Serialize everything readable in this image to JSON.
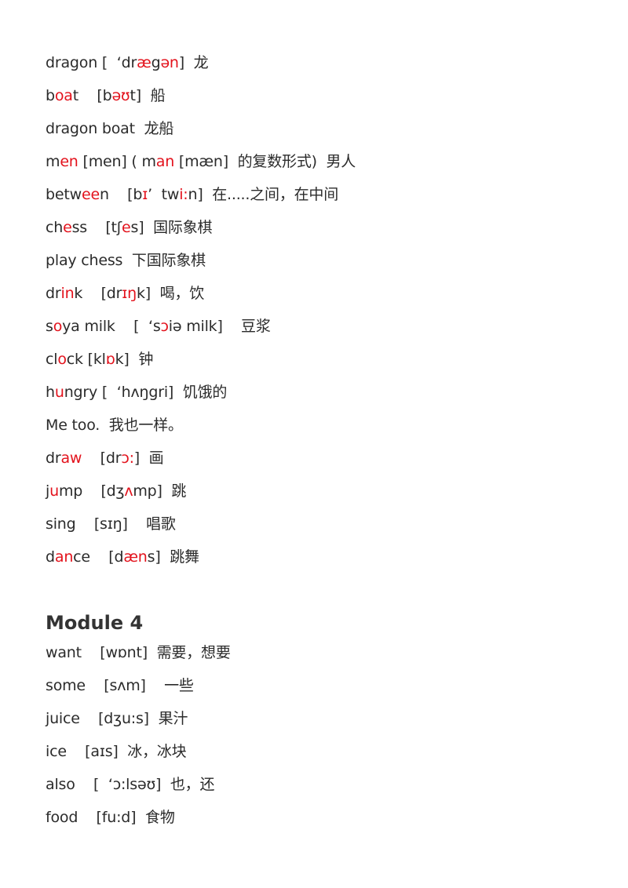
{
  "colors": {
    "text": "#2b2b2b",
    "highlight": "#e3121c"
  },
  "section1": {
    "entries": [
      {
        "id": "dragon",
        "segments": [
          {
            "t": "dragon [  ‘dr"
          },
          {
            "t": "æ",
            "h": true
          },
          {
            "t": "g"
          },
          {
            "t": "ən",
            "h": true
          },
          {
            "t": "]  龙"
          }
        ]
      },
      {
        "id": "boat",
        "segments": [
          {
            "t": "b"
          },
          {
            "t": "oa",
            "h": true
          },
          {
            "t": "t    [b"
          },
          {
            "t": "əʊ",
            "h": true
          },
          {
            "t": "t]  船"
          }
        ]
      },
      {
        "id": "dragon-boat",
        "segments": [
          {
            "t": "dragon boat  龙船"
          }
        ]
      },
      {
        "id": "men",
        "segments": [
          {
            "t": "m"
          },
          {
            "t": "en",
            "h": true
          },
          {
            "t": " [men] ( m"
          },
          {
            "t": "an",
            "h": true
          },
          {
            "t": " [mæn]  的复数形式)  男人"
          }
        ]
      },
      {
        "id": "between",
        "segments": [
          {
            "t": "betw"
          },
          {
            "t": "ee",
            "h": true
          },
          {
            "t": "n    [b"
          },
          {
            "t": "ɪ",
            "h": true
          },
          {
            "t": "’  tw"
          },
          {
            "t": "i:",
            "h": true
          },
          {
            "t": "n]  在.....之间，在中间"
          }
        ]
      },
      {
        "id": "chess",
        "segments": [
          {
            "t": "ch"
          },
          {
            "t": "e",
            "h": true
          },
          {
            "t": "ss    [tʃ"
          },
          {
            "t": "e",
            "h": true
          },
          {
            "t": "s]  国际象棋"
          }
        ]
      },
      {
        "id": "play-chess",
        "segments": [
          {
            "t": "play chess  下国际象棋"
          }
        ]
      },
      {
        "id": "drink",
        "segments": [
          {
            "t": "dr"
          },
          {
            "t": "in",
            "h": true
          },
          {
            "t": "k    [dr"
          },
          {
            "t": "ɪŋ",
            "h": true
          },
          {
            "t": "k]  喝，饮"
          }
        ]
      },
      {
        "id": "soya-milk",
        "segments": [
          {
            "t": "s"
          },
          {
            "t": "o",
            "h": true
          },
          {
            "t": "ya milk    [  ‘s"
          },
          {
            "t": "ɔ",
            "h": true
          },
          {
            "t": "iə milk]    豆浆"
          }
        ]
      },
      {
        "id": "clock",
        "segments": [
          {
            "t": "cl"
          },
          {
            "t": "o",
            "h": true
          },
          {
            "t": "ck [kl"
          },
          {
            "t": "ɒ",
            "h": true
          },
          {
            "t": "k]  钟"
          }
        ]
      },
      {
        "id": "hungry",
        "segments": [
          {
            "t": "h"
          },
          {
            "t": "u",
            "h": true
          },
          {
            "t": "ngry [  ‘hʌŋgri]  饥饿的"
          }
        ]
      },
      {
        "id": "me-too",
        "segments": [
          {
            "t": "Me too.  我也一样。"
          }
        ]
      },
      {
        "id": "draw",
        "segments": [
          {
            "t": "dr"
          },
          {
            "t": "aw",
            "h": true
          },
          {
            "t": "    [dr"
          },
          {
            "t": "ɔ:",
            "h": true
          },
          {
            "t": "]  画"
          }
        ]
      },
      {
        "id": "jump",
        "segments": [
          {
            "t": "j"
          },
          {
            "t": "u",
            "h": true
          },
          {
            "t": "mp    [dʒ"
          },
          {
            "t": "ʌ",
            "h": true
          },
          {
            "t": "mp]  跳"
          }
        ]
      },
      {
        "id": "sing",
        "segments": [
          {
            "t": "sing    [sɪŋ]    唱歌"
          }
        ]
      },
      {
        "id": "dance",
        "segments": [
          {
            "t": "d"
          },
          {
            "t": "an",
            "h": true
          },
          {
            "t": "ce    [d"
          },
          {
            "t": "æn",
            "h": true
          },
          {
            "t": "s]  跳舞"
          }
        ]
      }
    ]
  },
  "section2": {
    "heading": "Module 4",
    "entries": [
      {
        "id": "want",
        "segments": [
          {
            "t": "want    [wɒnt]  需要，想要"
          }
        ]
      },
      {
        "id": "some",
        "segments": [
          {
            "t": "some    [sʌm]    一些"
          }
        ]
      },
      {
        "id": "juice",
        "segments": [
          {
            "t": "juice    [dʒu:s]  果汁"
          }
        ]
      },
      {
        "id": "ice",
        "segments": [
          {
            "t": "ice    [aɪs]  冰，冰块"
          }
        ]
      },
      {
        "id": "also",
        "segments": [
          {
            "t": "also    [  ‘ɔ:lsəʊ]  也，还"
          }
        ]
      },
      {
        "id": "food",
        "segments": [
          {
            "t": "food    [fu:d]  食物"
          }
        ]
      }
    ]
  }
}
